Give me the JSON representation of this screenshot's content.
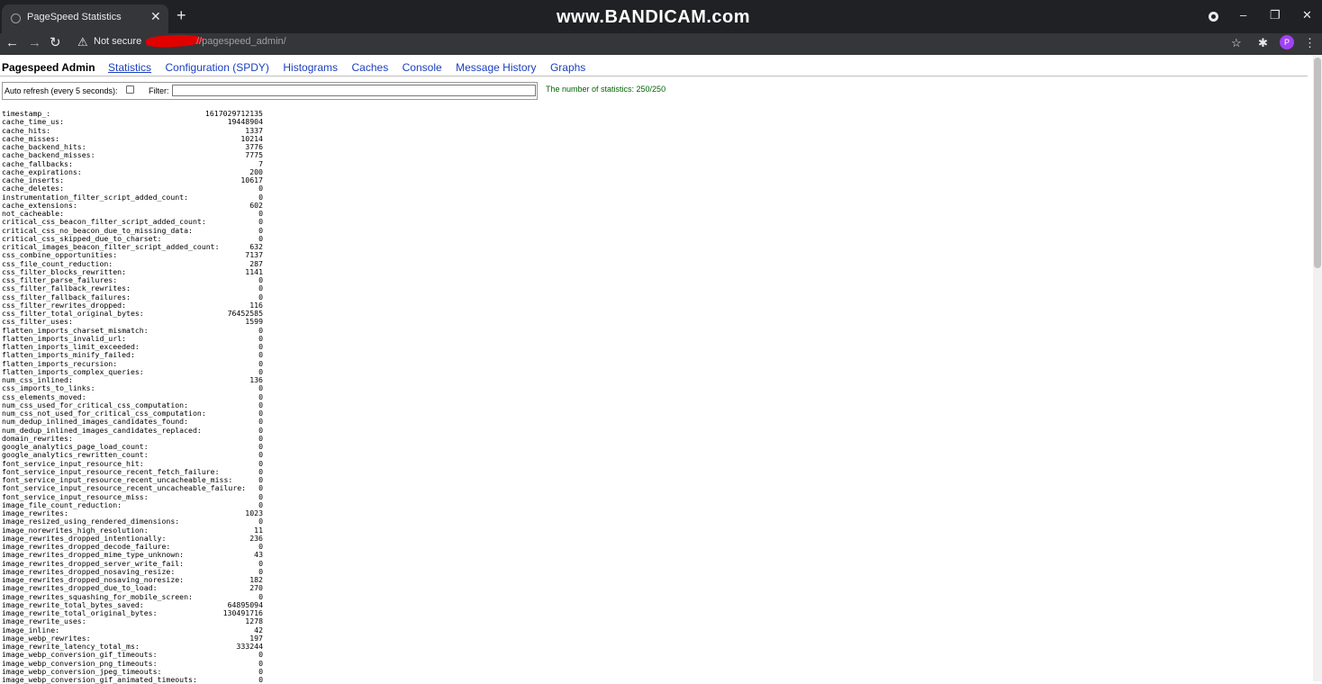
{
  "browser": {
    "tab_title": "PageSpeed Statistics",
    "tab_close": "✕",
    "new_tab": "+",
    "watermark": "www.BANDICAM.com",
    "minimize": "–",
    "maximize": "❐",
    "close": "✕",
    "back": "←",
    "forward": "→",
    "reload": "↻",
    "warning_icon": "⚠",
    "not_secure": "Not secure",
    "url": "//pagespeed_admin/",
    "star": "☆",
    "extensions": "✱",
    "profile_initial": "P",
    "menu": "⋮"
  },
  "nav": {
    "title": "Pagespeed Admin",
    "links": [
      "Statistics",
      "Configuration (SPDY)",
      "Histograms",
      "Caches",
      "Console",
      "Message History",
      "Graphs"
    ]
  },
  "filter_bar": {
    "auto_refresh_label": "Auto refresh (every 5 seconds):",
    "auto_refresh_checked": false,
    "filter_label": "Filter:",
    "filter_value": "",
    "count_text": "The number of statistics: 250/250"
  },
  "stats": [
    {
      "name": "timestamp_:",
      "value": "1617029712135"
    },
    {
      "name": "cache_time_us:",
      "value": "19448904"
    },
    {
      "name": "cache_hits:",
      "value": "1337"
    },
    {
      "name": "cache_misses:",
      "value": "10214"
    },
    {
      "name": "cache_backend_hits:",
      "value": "3776"
    },
    {
      "name": "cache_backend_misses:",
      "value": "7775"
    },
    {
      "name": "cache_fallbacks:",
      "value": "7"
    },
    {
      "name": "cache_expirations:",
      "value": "200"
    },
    {
      "name": "cache_inserts:",
      "value": "10617"
    },
    {
      "name": "cache_deletes:",
      "value": "0"
    },
    {
      "name": "instrumentation_filter_script_added_count:",
      "value": "0"
    },
    {
      "name": "cache_extensions:",
      "value": "602"
    },
    {
      "name": "not_cacheable:",
      "value": "0"
    },
    {
      "name": "critical_css_beacon_filter_script_added_count:",
      "value": "0"
    },
    {
      "name": "critical_css_no_beacon_due_to_missing_data:",
      "value": "0"
    },
    {
      "name": "critical_css_skipped_due_to_charset:",
      "value": "0"
    },
    {
      "name": "critical_images_beacon_filter_script_added_count:",
      "value": "632"
    },
    {
      "name": "css_combine_opportunities:",
      "value": "7137"
    },
    {
      "name": "css_file_count_reduction:",
      "value": "287"
    },
    {
      "name": "css_filter_blocks_rewritten:",
      "value": "1141"
    },
    {
      "name": "css_filter_parse_failures:",
      "value": "0"
    },
    {
      "name": "css_filter_fallback_rewrites:",
      "value": "0"
    },
    {
      "name": "css_filter_fallback_failures:",
      "value": "0"
    },
    {
      "name": "css_filter_rewrites_dropped:",
      "value": "116"
    },
    {
      "name": "css_filter_total_original_bytes:",
      "value": "76452585"
    },
    {
      "name": "css_filter_uses:",
      "value": "1599"
    },
    {
      "name": "flatten_imports_charset_mismatch:",
      "value": "0"
    },
    {
      "name": "flatten_imports_invalid_url:",
      "value": "0"
    },
    {
      "name": "flatten_imports_limit_exceeded:",
      "value": "0"
    },
    {
      "name": "flatten_imports_minify_failed:",
      "value": "0"
    },
    {
      "name": "flatten_imports_recursion:",
      "value": "0"
    },
    {
      "name": "flatten_imports_complex_queries:",
      "value": "0"
    },
    {
      "name": "num_css_inlined:",
      "value": "136"
    },
    {
      "name": "css_imports_to_links:",
      "value": "0"
    },
    {
      "name": "css_elements_moved:",
      "value": "0"
    },
    {
      "name": "num_css_used_for_critical_css_computation:",
      "value": "0"
    },
    {
      "name": "num_css_not_used_for_critical_css_computation:",
      "value": "0"
    },
    {
      "name": "num_dedup_inlined_images_candidates_found:",
      "value": "0"
    },
    {
      "name": "num_dedup_inlined_images_candidates_replaced:",
      "value": "0"
    },
    {
      "name": "domain_rewrites:",
      "value": "0"
    },
    {
      "name": "google_analytics_page_load_count:",
      "value": "0"
    },
    {
      "name": "google_analytics_rewritten_count:",
      "value": "0"
    },
    {
      "name": "font_service_input_resource_hit:",
      "value": "0"
    },
    {
      "name": "font_service_input_resource_recent_fetch_failure:",
      "value": "0"
    },
    {
      "name": "font_service_input_resource_recent_uncacheable_miss:",
      "value": "0"
    },
    {
      "name": "font_service_input_resource_recent_uncacheable_failure:",
      "value": "0"
    },
    {
      "name": "font_service_input_resource_miss:",
      "value": "0"
    },
    {
      "name": "image_file_count_reduction:",
      "value": "0"
    },
    {
      "name": "image_rewrites:",
      "value": "1023"
    },
    {
      "name": "image_resized_using_rendered_dimensions:",
      "value": "0"
    },
    {
      "name": "image_norewrites_high_resolution:",
      "value": "11"
    },
    {
      "name": "image_rewrites_dropped_intentionally:",
      "value": "236"
    },
    {
      "name": "image_rewrites_dropped_decode_failure:",
      "value": "0"
    },
    {
      "name": "image_rewrites_dropped_mime_type_unknown:",
      "value": "43"
    },
    {
      "name": "image_rewrites_dropped_server_write_fail:",
      "value": "0"
    },
    {
      "name": "image_rewrites_dropped_nosaving_resize:",
      "value": "0"
    },
    {
      "name": "image_rewrites_dropped_nosaving_noresize:",
      "value": "182"
    },
    {
      "name": "image_rewrites_dropped_due_to_load:",
      "value": "270"
    },
    {
      "name": "image_rewrites_squashing_for_mobile_screen:",
      "value": "0"
    },
    {
      "name": "image_rewrite_total_bytes_saved:",
      "value": "64895094"
    },
    {
      "name": "image_rewrite_total_original_bytes:",
      "value": "130491716"
    },
    {
      "name": "image_rewrite_uses:",
      "value": "1278"
    },
    {
      "name": "image_inline:",
      "value": "42"
    },
    {
      "name": "image_webp_rewrites:",
      "value": "197"
    },
    {
      "name": "image_rewrite_latency_total_ms:",
      "value": "333244"
    },
    {
      "name": "image_webp_conversion_gif_timeouts:",
      "value": "0"
    },
    {
      "name": "image_webp_conversion_png_timeouts:",
      "value": "0"
    },
    {
      "name": "image_webp_conversion_jpeg_timeouts:",
      "value": "0"
    },
    {
      "name": "image_webp_conversion_gif_animated_timeouts:",
      "value": "0"
    }
  ]
}
